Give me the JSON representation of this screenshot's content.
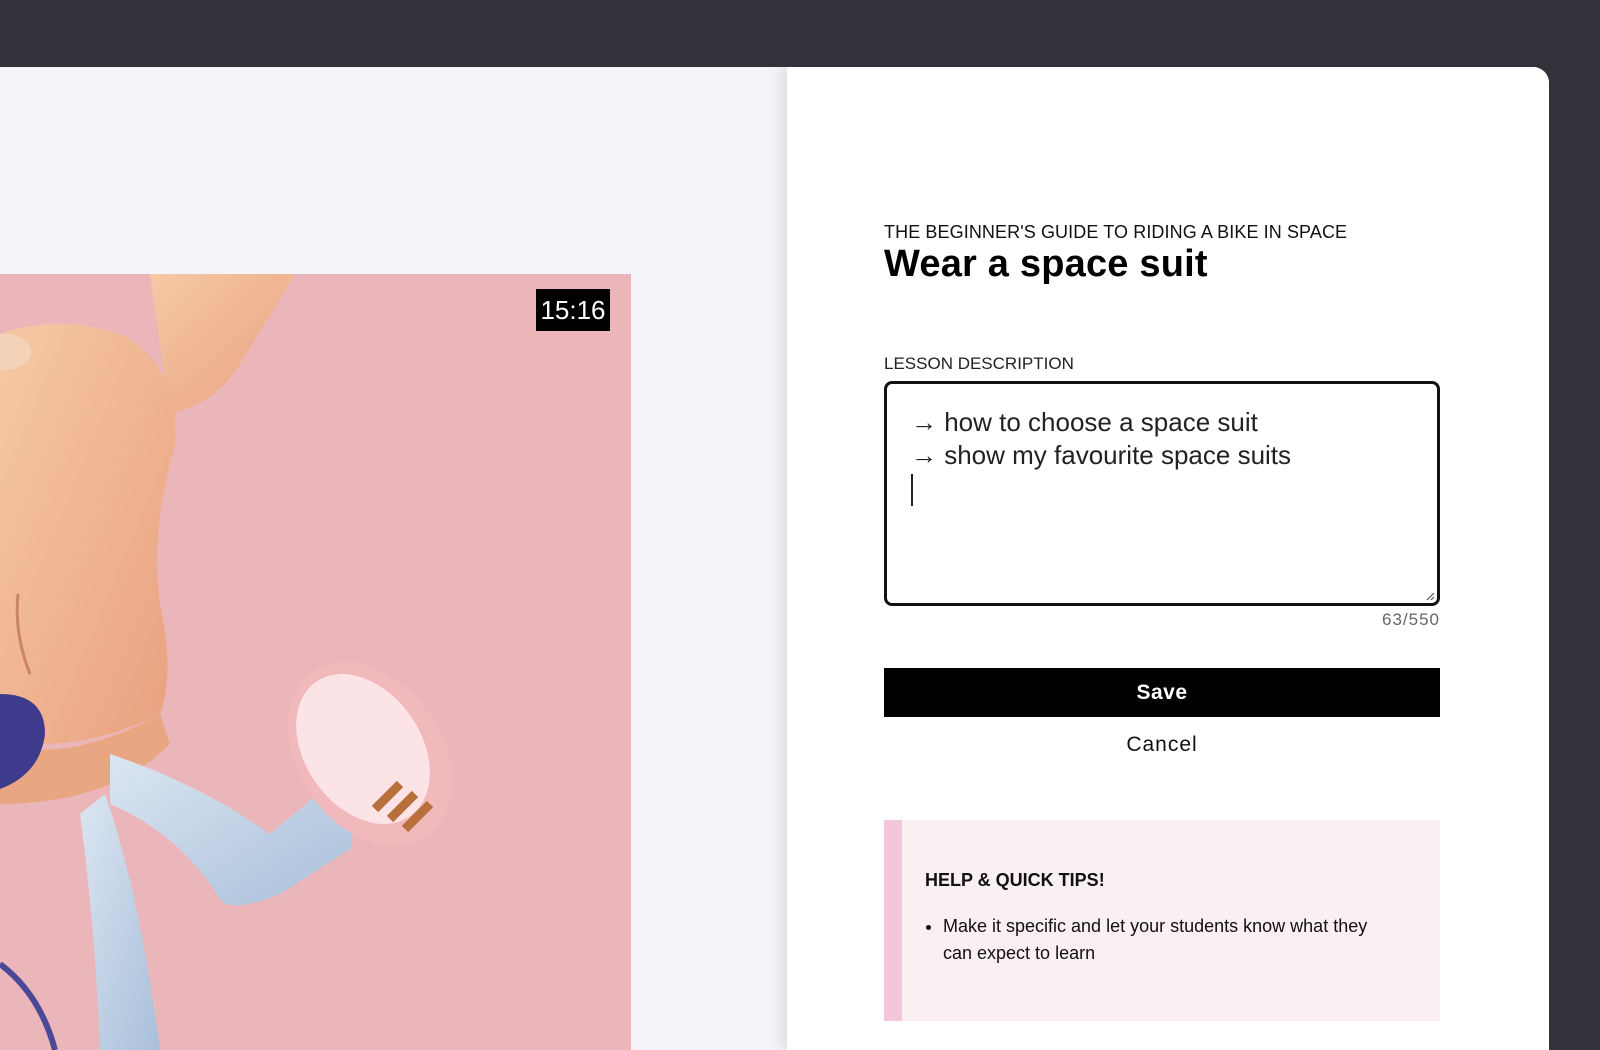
{
  "video": {
    "duration": "15:16"
  },
  "panel": {
    "course_title": "THE BEGINNER'S GUIDE TO RIDING A BIKE IN SPACE",
    "lesson_title": "Wear a space suit",
    "description_label": "LESSON DESCRIPTION",
    "description_lines": [
      "→ how to choose a space suit",
      "→ show my favourite space suits"
    ],
    "char_count": "63/550",
    "save_label": "Save",
    "cancel_label": "Cancel"
  },
  "tips": {
    "title": "HELP & QUICK TIPS!",
    "items": [
      "Make it specific and let your students know what they can expect to learn"
    ]
  },
  "colors": {
    "outer_bg": "#34313b",
    "app_bg": "#f3f5f9",
    "video_bg": "#ebb6b9",
    "tips_bg": "#faeff1",
    "tips_accent": "#f5c6db",
    "primary": "#000000"
  }
}
